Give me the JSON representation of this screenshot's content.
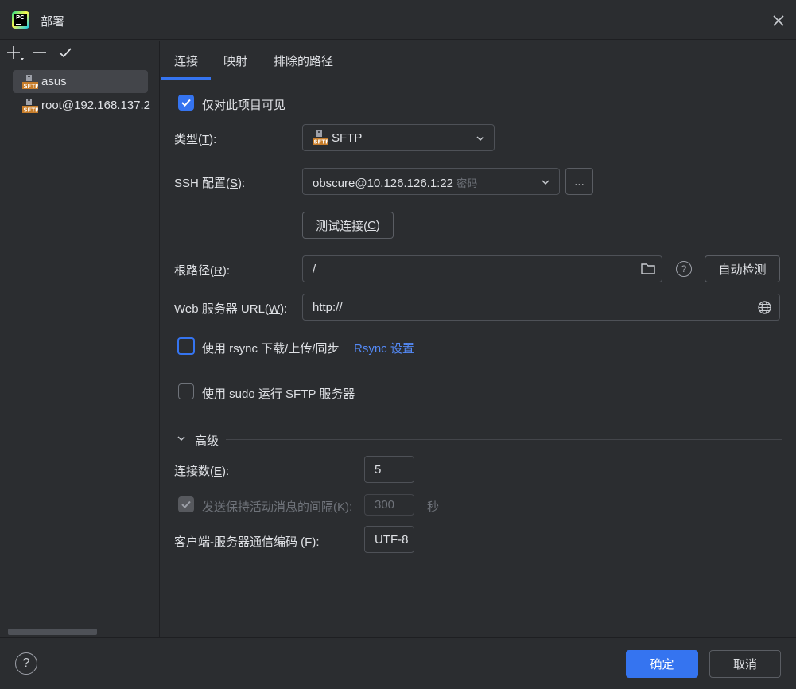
{
  "window": {
    "title": "部署"
  },
  "sidebar": {
    "tools": {
      "add": "+",
      "remove": "—",
      "apply": "✓"
    },
    "items": [
      {
        "label": "asus",
        "selected": true
      },
      {
        "label": "root@192.168.137.2",
        "selected": false
      }
    ],
    "item_icon": "sftp-server-icon"
  },
  "tabs": [
    {
      "label": "连接",
      "active": true
    },
    {
      "label": "映射",
      "active": false
    },
    {
      "label": "排除的路径",
      "active": false
    }
  ],
  "form": {
    "visible_only_project": {
      "label": "仅对此项目可见",
      "checked": true
    },
    "type": {
      "label_pre": "类型(",
      "label_key": "T",
      "label_post": "):",
      "value": "SFTP"
    },
    "ssh": {
      "label_pre": "SSH 配置(",
      "label_key": "S",
      "label_post": "):",
      "value": "obscure@10.126.126.1:22",
      "auth": "密码",
      "more": "..."
    },
    "test_connection": {
      "pre": "测试连接(",
      "key": "C",
      "post": ")"
    },
    "root_path": {
      "label_pre": "根路径(",
      "label_key": "R",
      "label_post": "):",
      "value": "/",
      "autodetect": "自动检测",
      "help": "?"
    },
    "web_url": {
      "label_pre": "Web 服务器 URL(",
      "label_key": "W",
      "label_post": "):",
      "value": "http://"
    },
    "rsync": {
      "label": "使用 rsync 下载/上传/同步",
      "checked": false,
      "link": "Rsync 设置"
    },
    "sudo": {
      "label": "使用 sudo 运行 SFTP 服务器",
      "checked": false
    }
  },
  "advanced": {
    "title": "高级",
    "connections": {
      "label_pre": "连接数(",
      "label_key": "E",
      "label_post": "):",
      "value": "5"
    },
    "keepalive": {
      "label_pre": "发送保持活动消息的间隔(",
      "label_key": "K",
      "label_post": "):",
      "value": "300",
      "unit": "秒",
      "checked": true,
      "disabled": true
    },
    "encoding": {
      "label_pre": "客户端-服务器通信编码 (",
      "label_key": "F",
      "label_post": "):",
      "value": "UTF-8"
    }
  },
  "footer": {
    "help": "?",
    "ok": "确定",
    "cancel": "取消"
  },
  "colors": {
    "accent": "#3574f0",
    "background": "#2b2d30",
    "link": "#548af7"
  }
}
